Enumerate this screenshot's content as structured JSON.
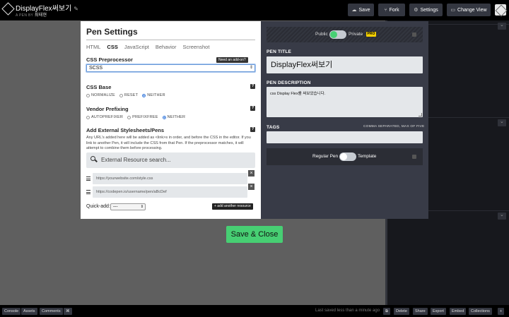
{
  "header": {
    "pen_title": "DisplayFlex써보기",
    "edit_icon": "pencil-icon",
    "by_prefix": "A PEN BY",
    "author": "최태현",
    "buttons": {
      "save": "Save",
      "fork": "Fork",
      "settings": "Settings",
      "change_view": "Change View"
    }
  },
  "modal": {
    "title": "Pen Settings",
    "tabs": [
      "HTML",
      "CSS",
      "JavaScript",
      "Behavior",
      "Screenshot"
    ],
    "active_tab": "CSS",
    "preprocessor": {
      "label": "CSS Preprocessor",
      "addon_button": "Need an add-on?",
      "selected": "SCSS"
    },
    "css_base": {
      "label": "CSS Base",
      "options": [
        "NORMALIZE",
        "RESET",
        "NEITHER"
      ],
      "selected": "NEITHER"
    },
    "vendor_prefixing": {
      "label": "Vendor Prefixing",
      "options": [
        "AUTOPREFIXER",
        "PREFIXFREE",
        "NEITHER"
      ],
      "selected": "NEITHER"
    },
    "external": {
      "label": "Add External Stylesheets/Pens",
      "description": "Any URL's added here will be added as <link>s in order, and before the CSS in the editor. If you link to another Pen, it will include the CSS from that Pen. If the preprocessor matches, it will attempt to combine them before processing.",
      "search_placeholder": "External Resource search...",
      "resource_placeholders": [
        "https://yourwebsite.com/style.css",
        "https://codepen.io/username/pen/aBcDef"
      ],
      "quick_add_label": "Quick-add:",
      "quick_add_selected": "---",
      "add_another": "+ add another resource"
    },
    "details": {
      "public_label": "Public",
      "private_label": "Private",
      "pro_badge": "PRO",
      "title_label": "PEN TITLE",
      "title_value": "DisplayFlex써보기",
      "description_label": "PEN DESCRIPTION",
      "description_value": "css Display Flex를 써보았습니다.",
      "tags_label": "TAGS",
      "tags_note": "COMMA SEPARATED, MAX OF FIVE",
      "tags_value": "",
      "regular_label": "Regular Pen",
      "template_label": "Template"
    },
    "save_close": "Save & Close"
  },
  "footer": {
    "left_buttons": [
      "Console",
      "Assets",
      "Comments"
    ],
    "saved_message": "Last saved less than a minute ago",
    "right_buttons": [
      "Delete",
      "Share",
      "Export",
      "Embed",
      "Collections"
    ]
  },
  "colors": {
    "accent_green": "#47cf73",
    "pro_yellow": "#f5d000",
    "panel_dark": "#383b47"
  }
}
